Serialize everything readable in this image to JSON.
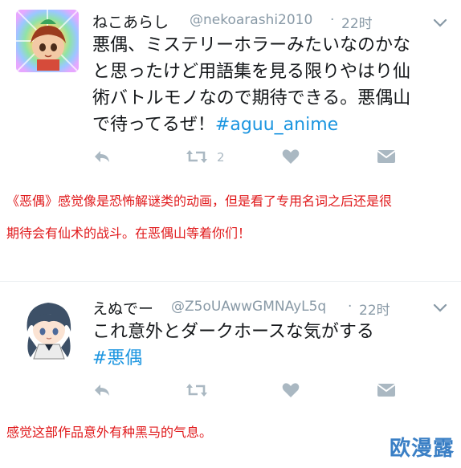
{
  "tweets": [
    {
      "name": "ねこあらし",
      "handle": "@nekoarashi2010",
      "time": "22时",
      "body_lines": [
        "悪偶、ミステリーホラーみたいなのかな",
        "と思ったけど用語集を見る限りやはり仙",
        "術バトルモノなので期待できる。悪偶山",
        "で待ってるぜ！"
      ],
      "hashtag": "#aguu_anime",
      "retweet_count": "2",
      "avatar_icon": "anime-character-avatar"
    },
    {
      "name": "えぬでー",
      "handle": "@Z5oUAwwGMNAyL5q",
      "time": "22时",
      "body_lines": [
        "これ意外とダークホースな気がする"
      ],
      "hashtag": "#悪偶",
      "avatar_icon": "anime-character-avatar"
    }
  ],
  "captions": {
    "first_line1": "《恶偶》感觉像是恐怖解谜类的动画，但是看了专用名词之后还是很",
    "first_line2": "期待会有仙术的战斗。在恶偶山等着你们！",
    "second": "感觉这部作品意外有种黑马的气息。"
  },
  "watermark": "欧漫露",
  "colors": {
    "caption": "#e0191b",
    "hashtag": "#1b95e0",
    "meta": "#8899a6",
    "icon": "#aab8c2"
  }
}
